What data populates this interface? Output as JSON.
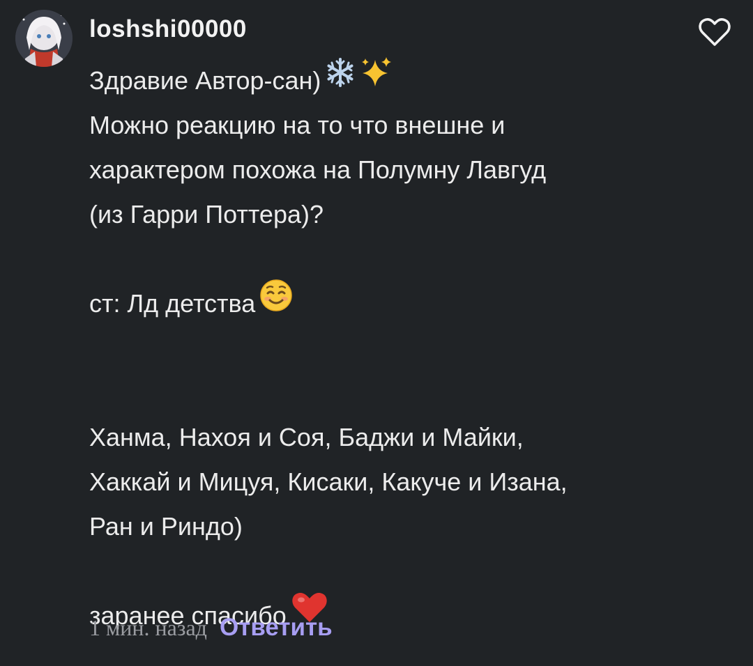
{
  "comment": {
    "username": "loshshi00000",
    "lines": [
      "Здравие Автор-сан)",
      "Можно реакцию на то что внешне и",
      "характером похожа на Полумну Лавгуд",
      "(из Гарри Поттера)?",
      "",
      "ст: Лд детства",
      "",
      "",
      "Ханма, Нахоя и Соя, Баджи и Майки,",
      "Хаккай и Мицуя, Кисаки, Какуче и Изана,",
      "Ран и Риндо)",
      "",
      "заранее спасибо"
    ],
    "emojis": {
      "line1": [
        "snowflake",
        "sparkles"
      ],
      "line6": [
        "smiling-face"
      ],
      "line13": [
        "red-heart"
      ]
    },
    "time": "1 мин. назад",
    "reply_label": "Ответить"
  },
  "colors": {
    "background": "#202326",
    "text": "#ececec",
    "muted": "#9a9ca1",
    "accent": "#a79ef2"
  }
}
